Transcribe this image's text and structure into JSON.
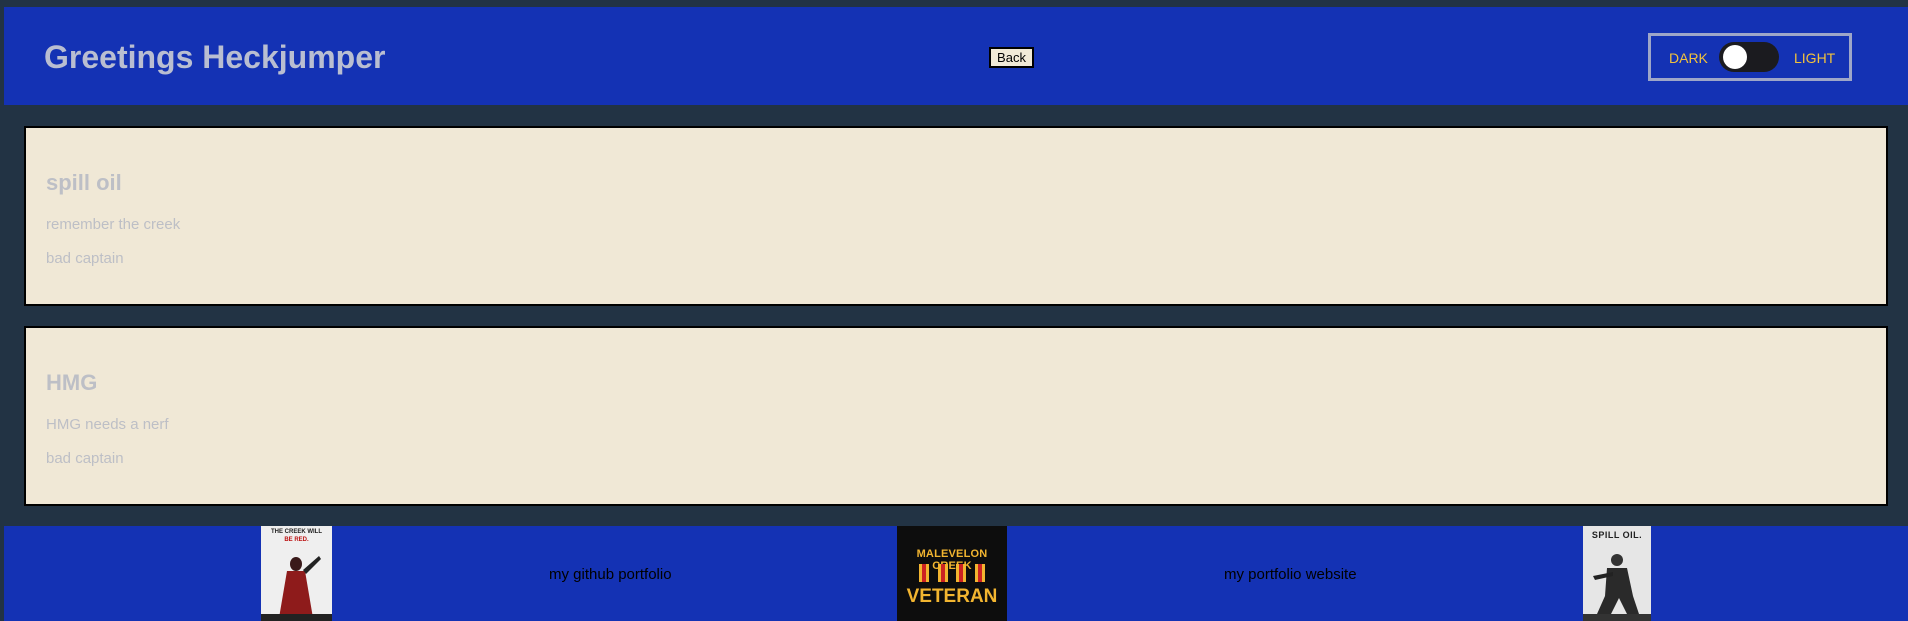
{
  "header": {
    "title": "Greetings Heckjumper",
    "back_label": "Back",
    "theme": {
      "dark_label": "DARK",
      "light_label": "LIGHT",
      "state": "dark"
    }
  },
  "cards": [
    {
      "title": "spill oil",
      "body": "remember the creek",
      "author": "bad captain"
    },
    {
      "title": "HMG",
      "body": "HMG needs a nerf",
      "author": "bad captain"
    }
  ],
  "footer": {
    "github_link": "my github portfolio",
    "portfolio_link": "my portfolio website",
    "poster1": {
      "text_line1": "THE CREEK WILL",
      "text_line2": "BE RED."
    },
    "poster2": {
      "top": "MALEVELON CREEK",
      "bottom": "VETERAN"
    },
    "poster3": {
      "title": "SPILL OIL."
    }
  },
  "colors": {
    "header_bg": "#1432b4",
    "page_bg": "#223344",
    "card_bg": "#f0e8d6",
    "accent_yellow": "#f2c23c"
  }
}
